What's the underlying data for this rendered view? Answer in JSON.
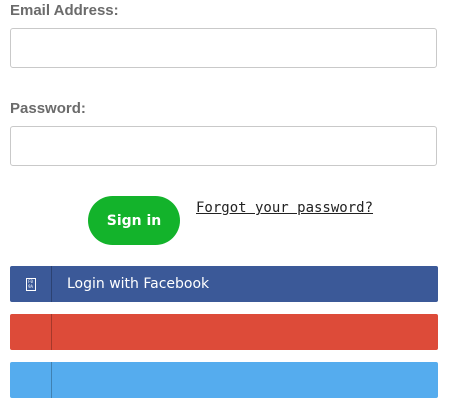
{
  "form": {
    "email_label": "Email Address:",
    "email_value": "",
    "password_label": "Password:",
    "password_value": "",
    "signin_label": "Sign in",
    "forgot_label": "Forgot your password?"
  },
  "social": {
    "facebook": {
      "label": "Login with Facebook",
      "icon": "facebook-icon",
      "icon_glyph_top": "F0",
      "icon_glyph_bottom": "9A",
      "color": "#3b5998"
    },
    "google": {
      "label": "",
      "icon": "google-icon",
      "color": "#dd4b39"
    },
    "twitter": {
      "label": "",
      "icon": "twitter-icon",
      "color": "#55acee"
    }
  },
  "colors": {
    "signin": "#13b32b",
    "label_text": "#6b6b6b"
  }
}
